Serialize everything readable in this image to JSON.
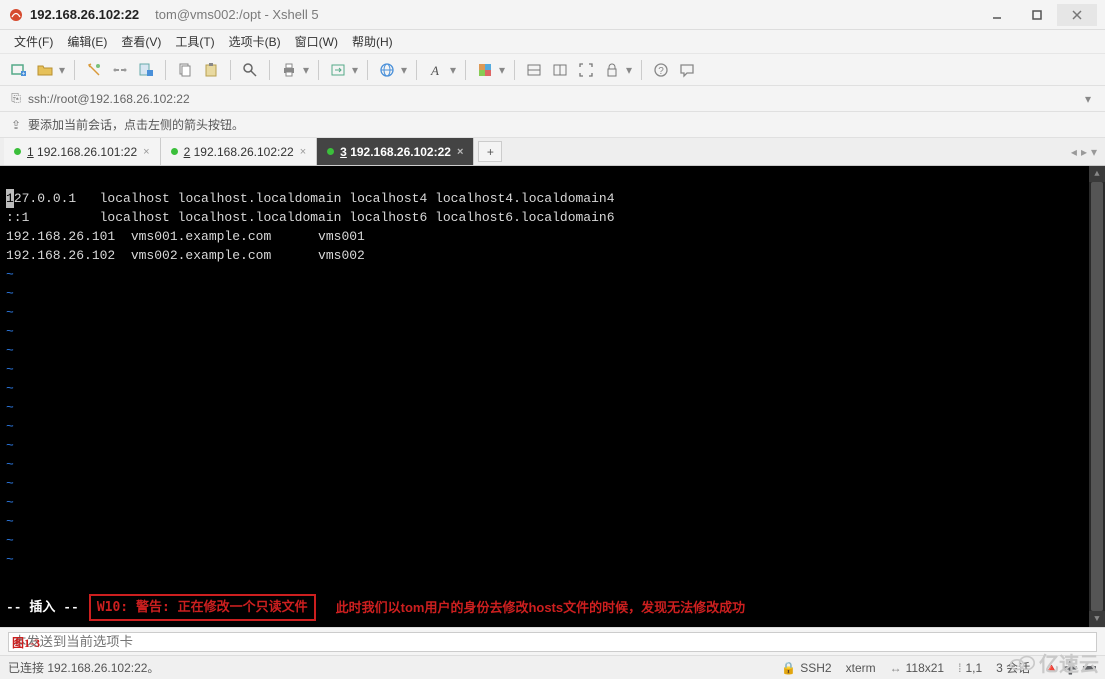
{
  "window": {
    "host": "192.168.26.102:22",
    "session_title": "tom@vms002:/opt - Xshell 5"
  },
  "menu": {
    "file": "文件(F)",
    "edit": "编辑(E)",
    "view": "查看(V)",
    "tools": "工具(T)",
    "tabs": "选项卡(B)",
    "window": "窗口(W)",
    "help": "帮助(H)"
  },
  "address": {
    "url": "ssh://root@192.168.26.102:22"
  },
  "hint": {
    "text": "要添加当前会话，点击左侧的箭头按钮。"
  },
  "tabs": [
    {
      "num": "1",
      "label": "192.168.26.101:22",
      "active": false
    },
    {
      "num": "2",
      "label": "192.168.26.102:22",
      "active": false
    },
    {
      "num": "3",
      "label": "192.168.26.102:22",
      "active": true
    }
  ],
  "terminal": {
    "lines": [
      "127.0.0.1   localhost localhost.localdomain localhost4 localhost4.localdomain4",
      "::1         localhost localhost.localdomain localhost6 localhost6.localdomain6",
      "192.168.26.101  vms001.example.com      vms001",
      "192.168.26.102  vms002.example.com      vms002"
    ],
    "cursor_char": "1",
    "mode": "-- 插入 --",
    "warning": "W10: 警告: 正在修改一个只读文件",
    "note": "此时我们以tom用户的身份去修改hosts文件的时候，发现无法修改成功"
  },
  "sendbar": {
    "placeholder": "本发送到当前选项卡",
    "figure_label": "图1-3"
  },
  "status": {
    "connection": "已连接 192.168.26.102:22。",
    "protocol": "SSH2",
    "term_type": "xterm",
    "size": "118x21",
    "pos": "1,1",
    "sessions": "3 会话"
  },
  "watermark": "亿速云"
}
